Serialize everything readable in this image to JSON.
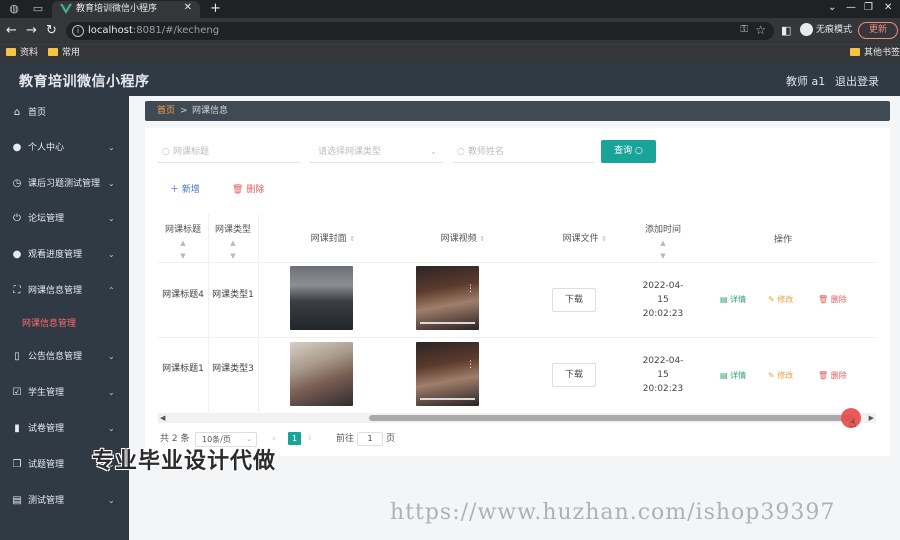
{
  "browser": {
    "tab_title": "教育培训微信小程序",
    "new_tab_icon": "plus-icon",
    "url_host": "localhost",
    "url_rest": ":8081/#/kecheng",
    "incognito_label": "无痕模式",
    "update_label": "更新",
    "bookmarks": [
      "资料",
      "常用"
    ],
    "other_bookmarks": "其他书签"
  },
  "app": {
    "title": "教育培训微信小程序",
    "user": "教师 a1",
    "logout": "退出登录"
  },
  "sidebar": {
    "items": [
      {
        "label": "首页",
        "icon": "home-icon"
      },
      {
        "label": "个人中心",
        "icon": "user-icon"
      },
      {
        "label": "课后习题测试管理",
        "icon": "clock-icon"
      },
      {
        "label": "论坛管理",
        "icon": "power-icon"
      },
      {
        "label": "观看进度管理",
        "icon": "user-icon"
      },
      {
        "label": "网课信息管理",
        "icon": "fullscreen-icon"
      },
      {
        "label": "公告信息管理",
        "icon": "phone-icon"
      },
      {
        "label": "学生管理",
        "icon": "checkbox-icon"
      },
      {
        "label": "试卷管理",
        "icon": "bar-chart-icon"
      },
      {
        "label": "试题管理",
        "icon": "copy-icon"
      },
      {
        "label": "测试管理",
        "icon": "clipboard-icon"
      }
    ],
    "active_sub": "网课信息管理"
  },
  "breadcrumb": {
    "home": "首页",
    "sep": ">",
    "current": "网课信息"
  },
  "search": {
    "title_placeholder": "网课标题",
    "type_placeholder": "请选择网课类型",
    "teacher_placeholder": "教师姓名",
    "query_label": "查询"
  },
  "actions": {
    "add": "新增",
    "delete": "删除"
  },
  "table": {
    "headers": [
      "网课标题",
      "网课类型",
      "网课封面",
      "网课视频",
      "网课文件",
      "添加时间",
      "操作"
    ],
    "rows": [
      {
        "title": "网课标题4",
        "type": "网课类型1",
        "file": "下载",
        "time": "2022-04-15 20:02:23"
      },
      {
        "title": "网课标题1",
        "type": "网课类型3",
        "file": "下载",
        "time": "2022-04-15 20:02:23"
      }
    ],
    "ops": {
      "detail": "详情",
      "edit": "修改",
      "remove": "删除"
    }
  },
  "pager": {
    "total": "共 2 条",
    "page_size": "10条/页",
    "current_page": "1",
    "goto_label": "前往",
    "goto_value": "1",
    "page_suffix": "页"
  },
  "watermark": {
    "overlay": "专业毕业设计代做",
    "url": "https://www.huzhan.com/ishop39397"
  }
}
